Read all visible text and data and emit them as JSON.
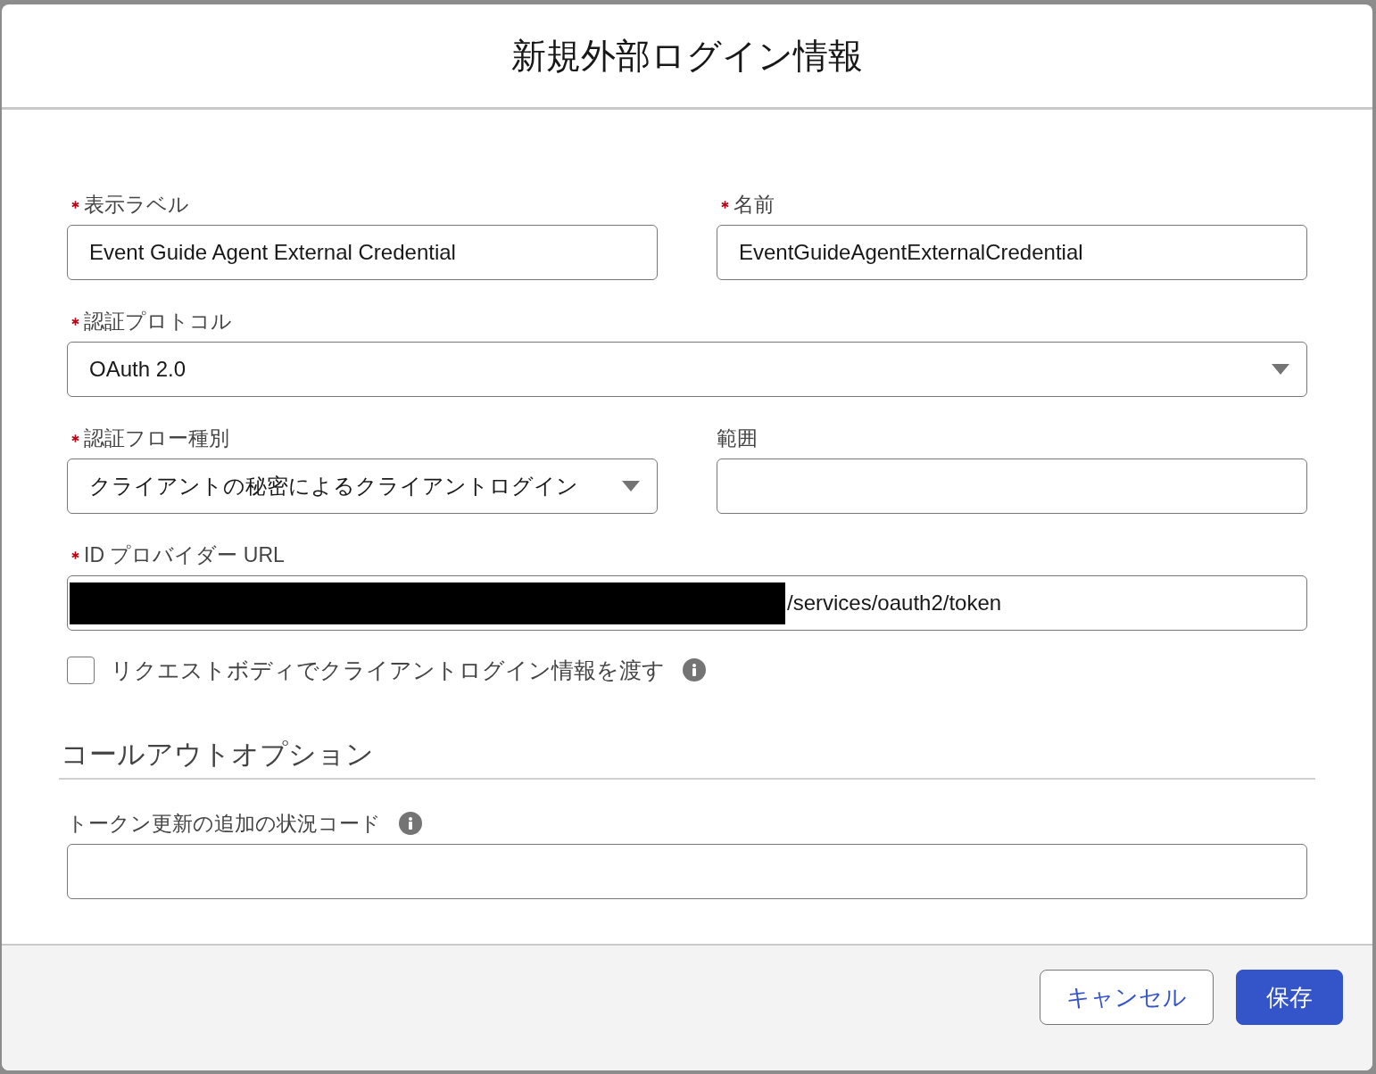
{
  "dialog": {
    "title": "新規外部ログイン情報"
  },
  "form": {
    "rows": [
      {
        "fields": [
          {
            "label": "表示ラベル",
            "required": true,
            "kind": "text",
            "value": "Event Guide Agent External Credential"
          },
          {
            "label": "名前",
            "required": true,
            "kind": "text",
            "value": "EventGuideAgentExternalCredential"
          }
        ]
      },
      {
        "fields": [
          {
            "label": "認証プロトコル",
            "required": true,
            "kind": "select",
            "value": "OAuth 2.0"
          }
        ]
      },
      {
        "fields": [
          {
            "label": "認証フロー種別",
            "required": true,
            "kind": "select",
            "value": "クライアントの秘密によるクライアントログイン"
          },
          {
            "label": "範囲",
            "required": false,
            "kind": "text"
          }
        ]
      },
      {
        "fields": [
          {
            "label": "ID プロバイダー URL",
            "required": true,
            "kind": "text",
            "redacted": true,
            "value": "/services/oauth2/token"
          }
        ]
      }
    ],
    "checkbox": {
      "label": "リクエストボディでクライアントログイン情報を渡す",
      "checked": false,
      "info": true
    }
  },
  "section": {
    "title": "コールアウトオプション",
    "fields": [
      {
        "label": "トークン更新の追加の状況コード",
        "required": false,
        "info": true,
        "kind": "text"
      }
    ]
  },
  "footer": {
    "buttons": [
      {
        "label": "キャンセル",
        "kind": "neutral"
      },
      {
        "label": "保存",
        "kind": "brand"
      }
    ]
  }
}
